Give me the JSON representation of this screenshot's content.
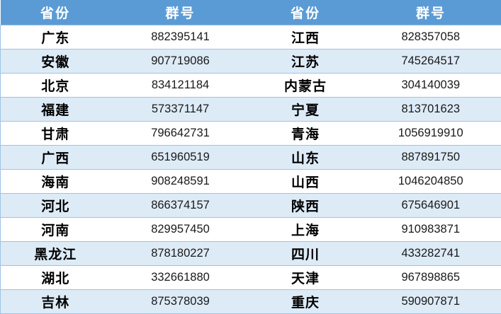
{
  "table": {
    "headers": [
      "省份",
      "群号",
      "省份",
      "群号"
    ],
    "rows": [
      {
        "left_province": "广东",
        "left_group": "882395141",
        "right_province": "江西",
        "right_group": "828357058"
      },
      {
        "left_province": "安徽",
        "left_group": "907719086",
        "right_province": "江苏",
        "right_group": "745264517"
      },
      {
        "left_province": "北京",
        "left_group": "834121184",
        "right_province": "内蒙古",
        "right_group": "304140039"
      },
      {
        "left_province": "福建",
        "left_group": "573371147",
        "right_province": "宁夏",
        "right_group": "813701623"
      },
      {
        "left_province": "甘肃",
        "left_group": "796642731",
        "right_province": "青海",
        "right_group": "1056919910"
      },
      {
        "left_province": "广西",
        "left_group": "651960519",
        "right_province": "山东",
        "right_group": "887891750"
      },
      {
        "left_province": "海南",
        "left_group": "908248591",
        "right_province": "山西",
        "right_group": "1046204850"
      },
      {
        "left_province": "河北",
        "left_group": "866374157",
        "right_province": "陕西",
        "right_group": "675646901"
      },
      {
        "left_province": "河南",
        "left_group": "829957450",
        "right_province": "上海",
        "right_group": "910983871"
      },
      {
        "left_province": "黑龙江",
        "left_group": "878180227",
        "right_province": "四川",
        "right_group": "433282741"
      },
      {
        "left_province": "湖北",
        "left_group": "332661880",
        "right_province": "天津",
        "right_group": "967898865"
      },
      {
        "left_province": "吉林",
        "left_group": "875378039",
        "right_province": "重庆",
        "right_group": "590907871"
      }
    ]
  },
  "colors": {
    "header_bg": "#5b9bd5",
    "header_text": "#ffffff",
    "stripe_bg": "#ddebf7",
    "row_bg": "#ffffff",
    "grid_line": "#9dc3e6"
  }
}
